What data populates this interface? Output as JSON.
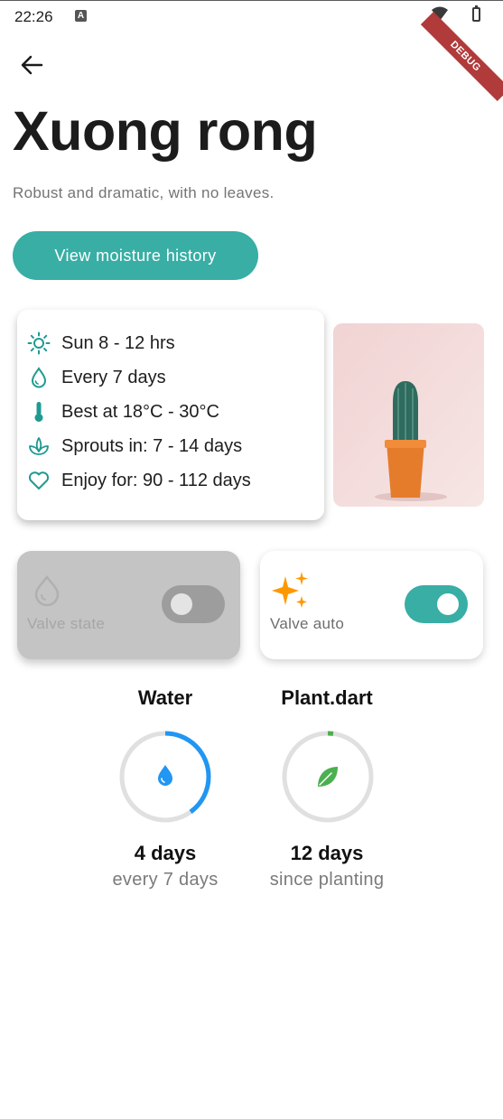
{
  "status_bar": {
    "time": "22:26",
    "notification_badge": "A",
    "debug_label": "DEBUG"
  },
  "plant": {
    "name": "Xuong rong",
    "description": "Robust and dramatic, with no leaves."
  },
  "actions": {
    "history_label": "View moisture history"
  },
  "care_info": [
    {
      "icon": "sun-icon",
      "text": "Sun 8 - 12 hrs"
    },
    {
      "icon": "water-drop-icon",
      "text": "Every 7 days"
    },
    {
      "icon": "thermometer-icon",
      "text": "Best at 18°C - 30°C"
    },
    {
      "icon": "sprout-icon",
      "text": "Sprouts in: 7 - 14 days"
    },
    {
      "icon": "heart-icon",
      "text": "Enjoy for: 90 - 112 days"
    }
  ],
  "controls": {
    "valve_state": {
      "label": "Valve state",
      "enabled": false,
      "on": false,
      "icon": "water-drop-icon"
    },
    "valve_auto": {
      "label": "Valve auto",
      "enabled": true,
      "on": true,
      "icon": "sparkles-icon"
    }
  },
  "stats": [
    {
      "title": "Water",
      "value": "4 days",
      "caption": "every 7 days",
      "progress": 0.4,
      "icon": "water-drop-icon",
      "color": "#2196f3"
    },
    {
      "title": "Plant.dart",
      "value": "12 days",
      "caption": "since planting",
      "progress": 0.02,
      "icon": "leaf-icon",
      "color": "#4caf50"
    }
  ],
  "colors": {
    "accent": "#38aea5",
    "icon_teal": "#1e9a90",
    "sparkle": "#ff9800"
  }
}
